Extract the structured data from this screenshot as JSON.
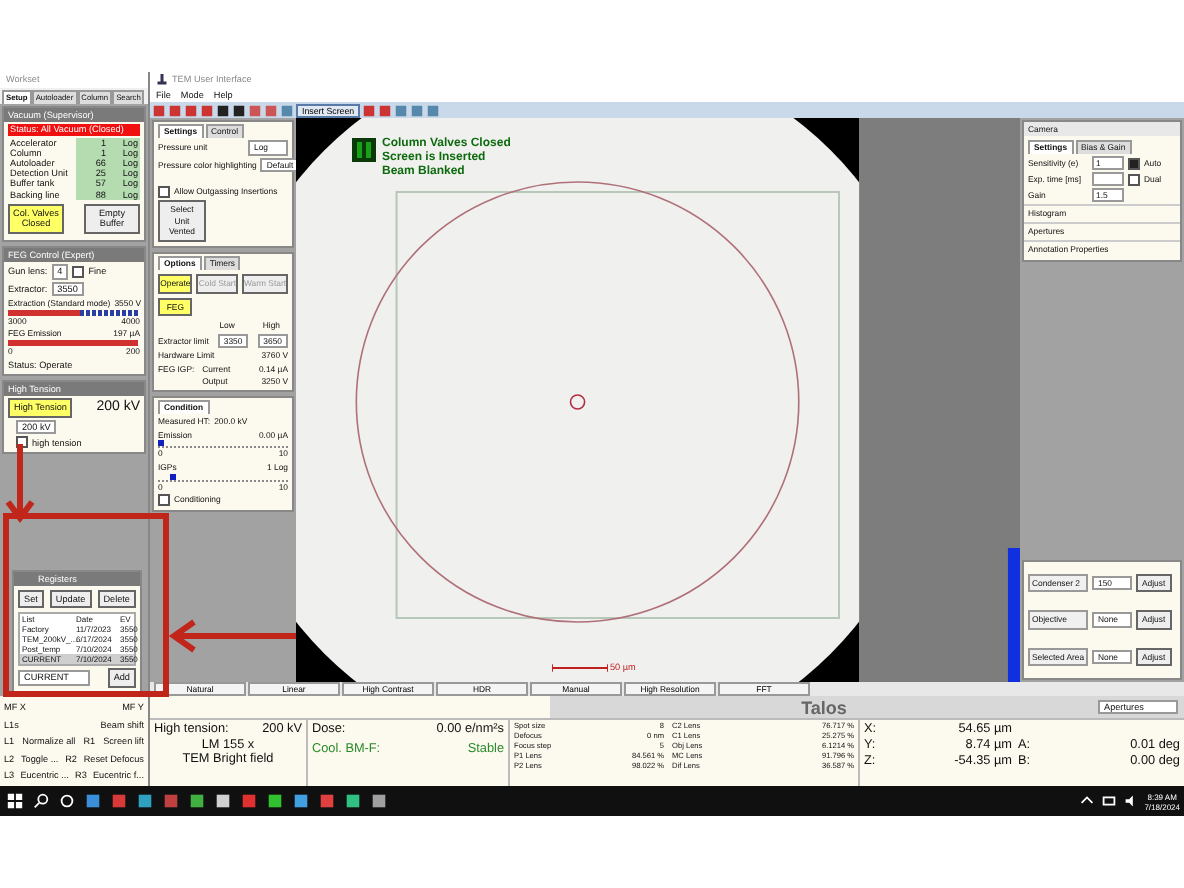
{
  "workset": {
    "title": "Workset",
    "tabs": [
      {
        "label": "Setup",
        "selected": true
      },
      {
        "label": "Autoloader",
        "selected": false
      },
      {
        "label": "Column",
        "selected": false
      },
      {
        "label": "Search",
        "selected": false
      }
    ],
    "vacuum": {
      "title": "Vacuum (Supervisor)",
      "status": "Status: All Vacuum (Closed)",
      "gauges": [
        {
          "name": "Accelerator",
          "value": "1",
          "unit": "Log"
        },
        {
          "name": "Column",
          "value": "1",
          "unit": "Log"
        },
        {
          "name": "Autoloader",
          "value": "66",
          "unit": "Log"
        },
        {
          "name": "Detection Unit",
          "value": "25",
          "unit": "Log"
        },
        {
          "name": "Buffer tank",
          "value": "57",
          "unit": "Log"
        },
        {
          "name": "Backing line",
          "value": "88",
          "unit": "Log"
        }
      ],
      "buttons": [
        {
          "label": "Col. Valves Closed",
          "highlighted": true
        },
        {
          "label": "Empty Buffer",
          "highlighted": false
        }
      ]
    },
    "feg": {
      "title": "FEG Control (Expert)",
      "gun_lens_label": "Gun lens:",
      "gun_lens": "4",
      "fine": {
        "label": "Fine",
        "checked": false
      },
      "extractor_label": "Extractor:",
      "extractor": "3550",
      "bars": [
        {
          "label": "Extraction (Standard mode)",
          "value": "3550",
          "unit": "V",
          "level": 0.55,
          "min": "3000",
          "max": "4000"
        },
        {
          "label": "FEG Emission",
          "value": "197",
          "unit": "µA",
          "level": 0.98,
          "min": "0",
          "max": "200"
        }
      ],
      "status": "Status: Operate"
    },
    "high_tension": {
      "title": "High Tension",
      "button": "High Tension",
      "value": "200 kV",
      "dropdown": "200 kV",
      "checkbox": {
        "label": "high tension",
        "checked": false
      }
    },
    "registers": {
      "title": "Registers",
      "buttons": [
        "Set",
        "Update",
        "Delete"
      ],
      "columns": [
        "List",
        "Date",
        "EV"
      ],
      "rows": [
        {
          "cells": [
            "Factory",
            "11/7/2023",
            "3550"
          ],
          "selected": false
        },
        {
          "cells": [
            "TEM_200kV_...",
            "6/17/2024",
            "3550"
          ],
          "selected": false
        },
        {
          "cells": [
            "Post_temp",
            "7/10/2024",
            "3550"
          ],
          "selected": false
        },
        {
          "cells": [
            "CURRENT",
            "7/10/2024",
            "3550"
          ],
          "selected": true
        }
      ],
      "name_value": "CURRENT",
      "add": "Add"
    },
    "keys": [
      {
        "left": "MF X",
        "right": "MF Y"
      },
      {
        "left": "L1s",
        "mid": "Beam shift"
      },
      {
        "left": "L1",
        "mid": "Normalize all",
        "key": "R1",
        "right": "Screen lift"
      },
      {
        "left": "L2",
        "mid": "Toggle ...",
        "key": "R2",
        "right": "Reset Defocus"
      },
      {
        "left": "L3",
        "mid": "Eucentric ...",
        "key": "R3",
        "right": "Eucentric f..."
      }
    ]
  },
  "tem": {
    "title": "TEM User Interface",
    "menu": [
      "File",
      "Mode",
      "Help"
    ],
    "insert_screen": "Insert Screen",
    "vacuum_settings": {
      "tabs": [
        {
          "label": "Settings",
          "selected": true
        },
        {
          "label": "Control",
          "selected": false
        }
      ],
      "rows": [
        {
          "label": "Pressure unit",
          "value": "Log"
        },
        {
          "label": "Pressure color highlighting",
          "value": "Default"
        }
      ],
      "outgassing": {
        "label": "Allow Outgassing Insertions",
        "checked": false
      },
      "vent": "Select Unit Vented"
    },
    "feg_options": {
      "tabs": [
        {
          "label": "Options",
          "selected": true
        },
        {
          "label": "Timers",
          "selected": false
        }
      ],
      "buttons": [
        {
          "label": "Operate",
          "highlighted": true,
          "disabled": false
        },
        {
          "label": "Cold Start",
          "highlighted": false,
          "disabled": true
        },
        {
          "label": "Warm Start",
          "highlighted": false,
          "disabled": true
        },
        {
          "label": "FEG",
          "highlighted": true,
          "disabled": false
        }
      ],
      "low": "Low",
      "high": "High",
      "limit_label": "Extractor limit",
      "low_value": "3350",
      "high_value": "3650",
      "hardware_label": "Hardware Limit",
      "hardware": "3760",
      "hardware_unit": "V",
      "igp_label": "FEG IGP:",
      "igp": [
        {
          "label": "Current",
          "value": "0.14",
          "unit": "µA"
        },
        {
          "label": "Output",
          "value": "3250",
          "unit": "V"
        }
      ]
    },
    "condition": {
      "title": "Condition",
      "measured_label": "Measured HT:",
      "measured": "200.0 kV",
      "scales": [
        {
          "label": "Emission",
          "value": "0.00 µA",
          "min": "0",
          "max": "10",
          "level": 0
        },
        {
          "label": "IGPs",
          "value": "1 Log",
          "min": "0",
          "max": "10",
          "level": 0.1
        }
      ],
      "conditioning": {
        "label": "Conditioning",
        "checked": false
      }
    },
    "messages": [
      "Column Valves Closed",
      "Screen is Inserted",
      "Beam Blanked"
    ],
    "scale_bar": "50 µm",
    "camera": {
      "title": "Camera",
      "tabs": [
        {
          "label": "Settings",
          "selected": true
        },
        {
          "label": "Bias & Gain",
          "selected": false
        }
      ],
      "rows": [
        {
          "label": "Sensitivity (e)",
          "value": "1",
          "check": "Auto",
          "checked": true
        },
        {
          "label": "Exp. time [ms]",
          "value": "",
          "check": "Dual",
          "checked": false
        },
        {
          "label": "Gain",
          "value": "1.5"
        }
      ],
      "sections": [
        "Histogram",
        "Apertures",
        "Annotation Properties"
      ]
    },
    "apertures": {
      "rows": [
        {
          "label": "Condenser 2",
          "value": "150",
          "button": "Adjust"
        },
        {
          "label": "Objective",
          "value": "None",
          "button": "Adjust"
        },
        {
          "label": "Selected Area",
          "value": "None",
          "button": "Adjust"
        }
      ]
    },
    "modes": [
      "Natural",
      "Linear",
      "High Contrast",
      "HDR",
      "Manual",
      "High Resolution",
      "FFT"
    ],
    "brand": "Talos",
    "panel_select": "Apertures",
    "status": {
      "ht_label": "High tension:",
      "ht": "200 kV",
      "mag": "LM 155 x",
      "mode": "TEM Bright field",
      "dose_label": "Dose:",
      "dose": "0.00 e/nm²s",
      "cool_label": "Cool. BM-F:",
      "cool": "Stable"
    },
    "lenses": [
      {
        "label": "Spot size",
        "value": "8",
        "label2": "C2 Lens",
        "value2": "76.717 %"
      },
      {
        "label": "Defocus",
        "value": "0 nm",
        "label2": "C1 Lens",
        "value2": "25.275 %"
      },
      {
        "label": "Focus step",
        "value": "5",
        "label2": "Obj Lens",
        "value2": "6.1214 %"
      },
      {
        "label": "P1 Lens",
        "value": "84.561 %",
        "label2": "MC Lens",
        "value2": "91.796 %"
      },
      {
        "label": "P2 Lens",
        "value": "98.022 %",
        "label2": "Dif Lens",
        "value2": "36.587 %"
      }
    ],
    "stage": [
      {
        "label": "X:",
        "value": "54.65 µm"
      },
      {
        "label": "Y:",
        "value": "8.74 µm",
        "label2": "A:",
        "value2": "0.01 deg"
      },
      {
        "label": "Z:",
        "value": "-54.35 µm",
        "label2": "B:",
        "value2": "0.00 deg"
      }
    ]
  },
  "taskbar": {
    "time": "8:39 AM",
    "date": "7/18/2024"
  }
}
